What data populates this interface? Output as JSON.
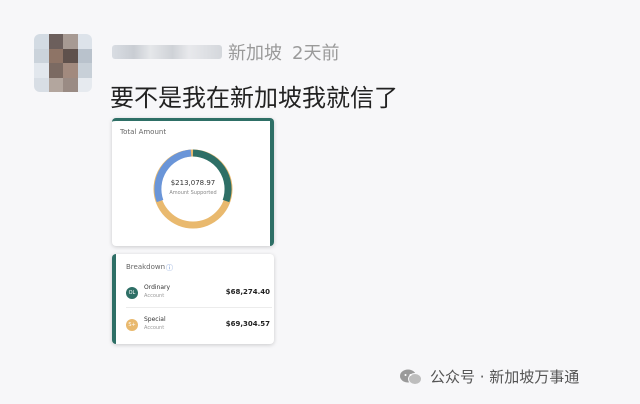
{
  "post": {
    "location_suffix": "新加坡",
    "time": "2天前",
    "comment": "要不是我在新加坡我就信了"
  },
  "total_card": {
    "title": "Total Amount",
    "amount": "$213,078.97",
    "sub": "Amount Supported"
  },
  "breakdown_card": {
    "title": "Breakdown",
    "info_icon": "info-icon",
    "rows": [
      {
        "badge": "OL",
        "name": "Ordinary",
        "sub": "Account",
        "amount": "$68,274.40",
        "color": "#2e6f66"
      },
      {
        "badge": "S+",
        "name": "Special",
        "sub": "Account",
        "amount": "$69,304.57",
        "color": "#e9b96e"
      }
    ]
  },
  "watermark": {
    "text": "公众号 · 新加坡万事通",
    "icon": "wechat-icon"
  },
  "colors": {
    "teal": "#2e6f66",
    "blue": "#6a95d8",
    "gold": "#e9b96e"
  }
}
